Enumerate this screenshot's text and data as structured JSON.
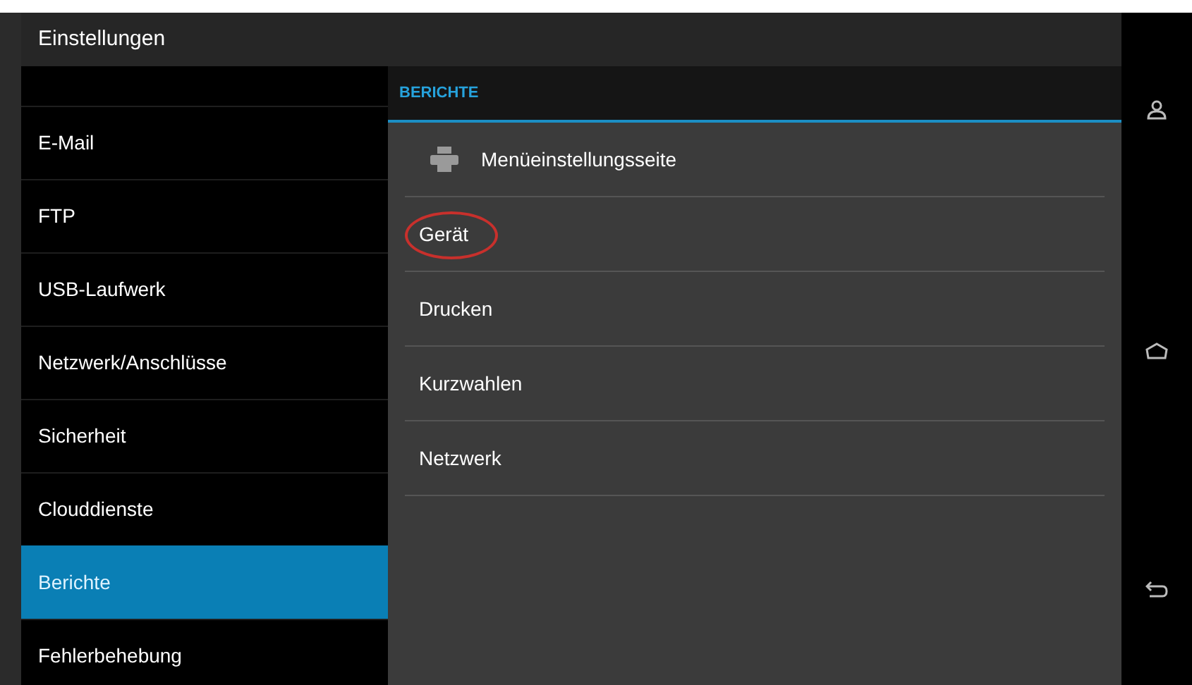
{
  "window": {
    "title": "Einstellungen"
  },
  "sidebar": {
    "items": [
      {
        "label": "E-Mail",
        "selected": false
      },
      {
        "label": "FTP",
        "selected": false
      },
      {
        "label": "USB-Laufwerk",
        "selected": false
      },
      {
        "label": "Netzwerk/Anschlüsse",
        "selected": false
      },
      {
        "label": "Sicherheit",
        "selected": false
      },
      {
        "label": "Clouddienste",
        "selected": false
      },
      {
        "label": "Berichte",
        "selected": true
      },
      {
        "label": "Fehlerbehebung",
        "selected": false
      }
    ]
  },
  "panel": {
    "heading": "BERICHTE",
    "items": [
      {
        "label": "Menüeinstellungsseite",
        "kind": "print",
        "circled": false
      },
      {
        "label": "Gerät",
        "kind": "plain",
        "circled": true
      },
      {
        "label": "Drucken",
        "kind": "plain",
        "circled": false
      },
      {
        "label": "Kurzwahlen",
        "kind": "plain",
        "circled": false
      },
      {
        "label": "Netzwerk",
        "kind": "plain",
        "circled": false
      }
    ]
  }
}
